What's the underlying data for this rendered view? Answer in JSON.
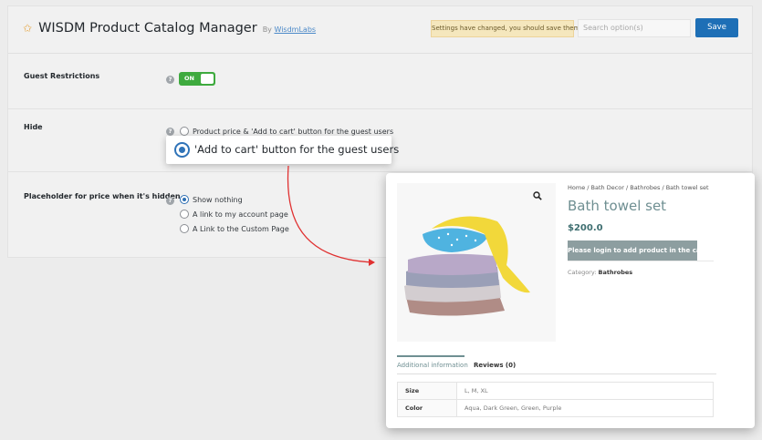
{
  "header": {
    "title": "WISDM Product Catalog Manager",
    "by": "By",
    "by_link": "WisdmLabs",
    "notice": "Settings have changed, you should save them!",
    "search_placeholder": "Search option(s)",
    "save_label": "Save"
  },
  "settings": {
    "guest_restrictions": {
      "label": "Guest Restrictions",
      "toggle": "ON"
    },
    "hide": {
      "label": "Hide",
      "options": [
        "Product price & 'Add to cart' button for the guest users",
        "'Add to cart' button for the guest users"
      ]
    },
    "placeholder": {
      "label": "Placeholder for price when it's hidden",
      "options": [
        "Show nothing",
        "A link to my account page",
        "A Link to the Custom Page"
      ]
    }
  },
  "callout": {
    "text": "'Add to cart' button for the guest users"
  },
  "product": {
    "breadcrumb": "Home / Bath Decor / Bathrobes / Bath towel set",
    "title": "Bath towel set",
    "price": "$200.0",
    "login_button": "Please login to add product in the cart",
    "category_label": "Category:",
    "category_value": "Bathrobes",
    "tabs": [
      "Additional information",
      "Reviews (0)"
    ],
    "attributes": [
      {
        "name": "Size",
        "value": "L, M, XL"
      },
      {
        "name": "Color",
        "value": "Aqua, Dark Green, Green, Purple"
      }
    ]
  },
  "colors": {
    "accent": "#1e6fb6",
    "toggle_on": "#3eaa3e",
    "arrow": "#e03131",
    "product_accent": "#6f8f92"
  }
}
